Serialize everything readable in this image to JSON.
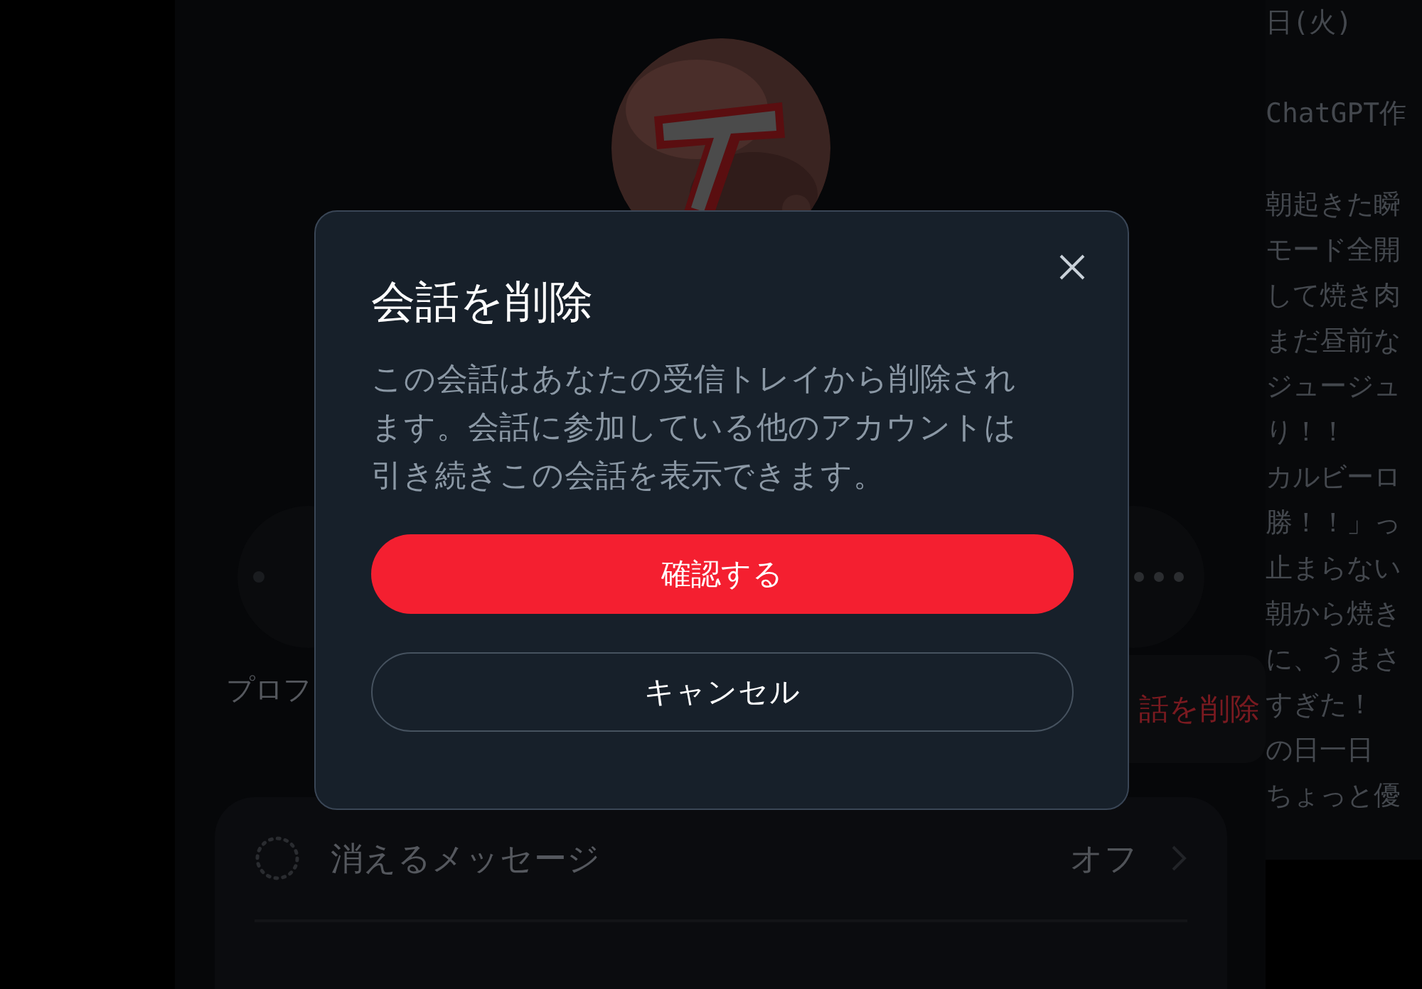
{
  "background": {
    "side_panel": {
      "paragraphs": [
        [
          "日(火)"
        ],
        [
          "ChatGPT作"
        ],
        [
          "朝起きた瞬",
          "モード全開",
          "して焼き肉",
          "まだ昼前な",
          "ジュージュ",
          "り！！",
          "カルビーロ",
          "勝！！」っ",
          "止まらない",
          "朝から焼き",
          "に、うまさ",
          "すぎた！",
          "の日一日",
          "ちょっと優"
        ]
      ]
    },
    "profile_label": "プロフ",
    "menu": {
      "item": "話を削除"
    },
    "settings": [
      {
        "label": "消えるメッセージ",
        "value": "オフ"
      }
    ]
  },
  "dialog": {
    "title": "会話を削除",
    "body": "この会話はあなたの受信トレイから削除されます。会話に参加している他のアカウントは引き続きこの会話を表示できます。",
    "buttons": [
      {
        "label": "確認する",
        "kind": "primary"
      },
      {
        "label": "キャンセル",
        "kind": "secondary"
      }
    ]
  }
}
